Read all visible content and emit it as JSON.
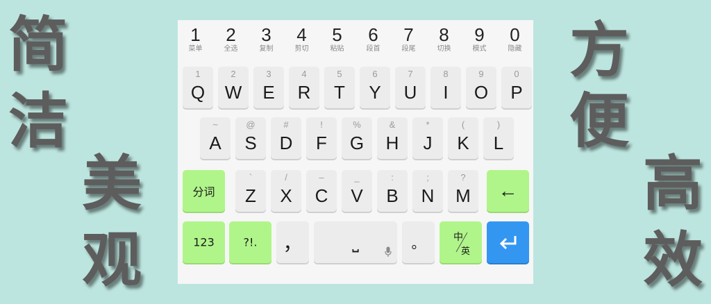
{
  "side_text": {
    "left_top": [
      "简",
      "洁"
    ],
    "left_bottom": [
      "美",
      "观"
    ],
    "right_top": [
      "方",
      "便"
    ],
    "right_bottom": [
      "高",
      "效"
    ]
  },
  "number_row": [
    {
      "digit": "1",
      "sub": "菜单"
    },
    {
      "digit": "2",
      "sub": "全选"
    },
    {
      "digit": "3",
      "sub": "复制"
    },
    {
      "digit": "4",
      "sub": "剪切"
    },
    {
      "digit": "5",
      "sub": "粘贴"
    },
    {
      "digit": "6",
      "sub": "段首"
    },
    {
      "digit": "7",
      "sub": "段尾"
    },
    {
      "digit": "8",
      "sub": "切换"
    },
    {
      "digit": "9",
      "sub": "模式"
    },
    {
      "digit": "0",
      "sub": "隐藏"
    }
  ],
  "row_q": [
    {
      "main": "Q",
      "hint": "1"
    },
    {
      "main": "W",
      "hint": "2"
    },
    {
      "main": "E",
      "hint": "3"
    },
    {
      "main": "R",
      "hint": "4"
    },
    {
      "main": "T",
      "hint": "5"
    },
    {
      "main": "Y",
      "hint": "6"
    },
    {
      "main": "U",
      "hint": "7"
    },
    {
      "main": "I",
      "hint": "8"
    },
    {
      "main": "O",
      "hint": "9"
    },
    {
      "main": "P",
      "hint": "0"
    }
  ],
  "row_a": [
    {
      "main": "A",
      "hint": "~"
    },
    {
      "main": "S",
      "hint": "@"
    },
    {
      "main": "D",
      "hint": "#"
    },
    {
      "main": "F",
      "hint": "!"
    },
    {
      "main": "G",
      "hint": "%"
    },
    {
      "main": "H",
      "hint": "&"
    },
    {
      "main": "J",
      "hint": "*"
    },
    {
      "main": "K",
      "hint": "("
    },
    {
      "main": "L",
      "hint": ")"
    }
  ],
  "row_z": [
    {
      "main": "Z",
      "hint": "`"
    },
    {
      "main": "X",
      "hint": "/"
    },
    {
      "main": "C",
      "hint": "–"
    },
    {
      "main": "V",
      "hint": "_"
    },
    {
      "main": "B",
      "hint": ":"
    },
    {
      "main": "N",
      "hint": ";"
    },
    {
      "main": "M",
      "hint": "?"
    }
  ],
  "keys": {
    "segment": "分词",
    "backspace": "←",
    "numbers": "123",
    "symbols": "?!.",
    "comma": "，",
    "space_glyph": "⎵",
    "period": "。",
    "lang_zh": "中",
    "lang_en": "英",
    "enter": "↵"
  },
  "colors": {
    "background": "#bde5df",
    "keyboard_bg": "#f6f6f6",
    "key_bg": "#ececec",
    "green_key": "#b0f58a",
    "blue_key": "#3397f2"
  }
}
